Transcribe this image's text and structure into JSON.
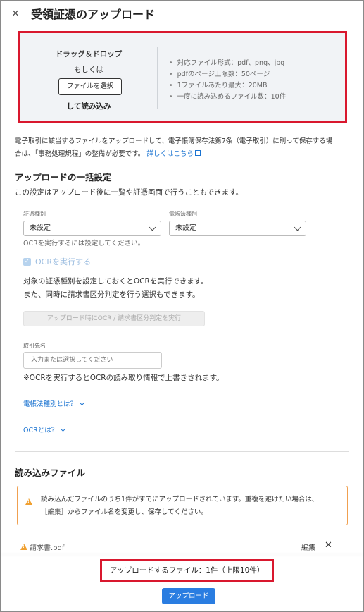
{
  "header": {
    "title": "受領証憑のアップロード",
    "close_icon": "×"
  },
  "dropzone": {
    "drag_text": "ドラッグ＆ドロップ",
    "or_text": "もしくは",
    "select_button": "ファイルを選択",
    "read_text": "して読み込み",
    "info": [
      "対応ファイル形式：pdf、png、jpg",
      "pdfのページ上限数：50ページ",
      "1ファイルあたり最大：20MB",
      "一度に読み込めるファイル数：10件"
    ]
  },
  "notice": {
    "line1": "電子取引に該当するファイルをアップロードして、電子帳簿保存法第7条（電子取引）に則って保存する場",
    "line2": "合は、「事務処理規程」の整備が必要です。",
    "link": "詳しくはこちら"
  },
  "bulk": {
    "heading": "アップロードの一括設定",
    "subtext": "この設定はアップロード後に一覧や証憑画面で行うこともできます。",
    "voucher_type_label": "証憑種別",
    "voucher_type_value": "未設定",
    "ebook_type_label": "電帳法種別",
    "ebook_type_value": "未設定",
    "ocr_hint": "OCRを実行するには設定してください。",
    "ocr_checkbox_label": "OCRを実行する",
    "ocr_desc1": "対象の証憑種別を設定しておくとOCRを実行できます。",
    "ocr_desc2": "また、同時に請求書区分判定を行う選択もできます。",
    "ocr_button": "アップロード時にOCR / 請求書区分判定を実行",
    "partner_label": "取引先名",
    "partner_placeholder": "入力または選択してください",
    "partner_note": "※OCRを実行するとOCRの読み取り情報で上書きされます。",
    "link_ebook": "電帳法種別とは？",
    "link_ocr": "OCRとは？"
  },
  "files": {
    "heading": "読み込みファイル",
    "alert_line1": "読み込んだファイルのうち1件がすでにアップロードされています。重複を避けたい場合は、",
    "alert_line2": "［編集］からファイル名を変更し、保存してください。",
    "items": [
      {
        "name": "請求書.pdf",
        "edit": "編集",
        "delete": "✕"
      }
    ]
  },
  "footer": {
    "count_text": "アップロードするファイル：1件（上限10件）",
    "upload_button": "アップロード"
  },
  "colors": {
    "accent": "#2a7de1",
    "highlight": "#d9182e",
    "warning": "#f0a030"
  }
}
